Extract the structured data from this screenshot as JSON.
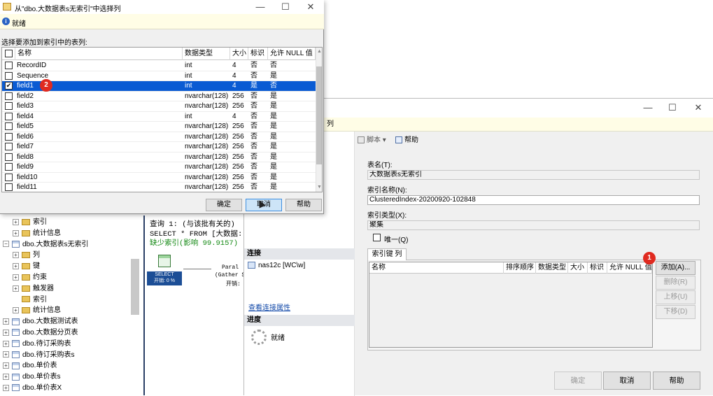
{
  "tree": {
    "rows": [
      {
        "label": "索引",
        "kind": "folder",
        "expander": "+"
      },
      {
        "label": "统计信息",
        "kind": "folder",
        "expander": "+"
      },
      {
        "label": "dbo.大数据表s无索引",
        "kind": "table",
        "expander": "−"
      },
      {
        "label": "列",
        "kind": "folder",
        "expander": "+"
      },
      {
        "label": "键",
        "kind": "folder",
        "expander": "+"
      },
      {
        "label": "约束",
        "kind": "folder",
        "expander": "+"
      },
      {
        "label": "触发器",
        "kind": "folder",
        "expander": "+"
      },
      {
        "label": "索引",
        "kind": "folder",
        "expander": ""
      },
      {
        "label": "统计信息",
        "kind": "folder",
        "expander": "+"
      },
      {
        "label": "dbo.大数据测试表",
        "kind": "table",
        "expander": "+"
      },
      {
        "label": "dbo.大数据分页表",
        "kind": "table",
        "expander": "+"
      },
      {
        "label": "dbo.待订采购表",
        "kind": "table",
        "expander": "+"
      },
      {
        "label": "dbo.待订采购表s",
        "kind": "table",
        "expander": "+"
      },
      {
        "label": "dbo.单价表",
        "kind": "table",
        "expander": "+"
      },
      {
        "label": "dbo.单价表s",
        "kind": "table",
        "expander": "+"
      },
      {
        "label": "dbo.单价表X",
        "kind": "table",
        "expander": "+"
      }
    ]
  },
  "query_plan": {
    "line1": "查询 1: (与该批有关的)",
    "line2": "SELECT * FROM [大数据:",
    "line3": "缺少索引(影响 99.9157)",
    "select_label": "SELECT",
    "select_cost": "开销: 0 %",
    "parallel_label": "Paral",
    "gather_label": "(Gather S",
    "parallel_cost": "开销:"
  },
  "index_dialog": {
    "minimize": "—",
    "maximize": "☐",
    "close": "✕",
    "status": "列",
    "toolbar_script": "脚本",
    "toolbar_help": "帮助",
    "connection_header": "连接",
    "connection_server": "nas12c [WC\\w]",
    "view_connection_link": "查看连接属性",
    "progress_header": "进度",
    "progress_status": "就绪",
    "table_name_label": "表名(T):",
    "table_name_value": "大数据表s无索引",
    "index_name_label": "索引名称(N):",
    "index_name_value": "ClusteredIndex-20200920-102848",
    "index_type_label": "索引类型(X):",
    "index_type_value": "聚集",
    "unique_label": "唯一(Q)",
    "key_columns_tab": "索引键 列",
    "key_columns_headers": [
      "名称",
      "排序顺序",
      "数据类型",
      "大小",
      "标识",
      "允许 NULL 值"
    ],
    "add_button": "添加(A)...",
    "remove_button": "删除(R)",
    "move_up_button": "上移(U)",
    "move_down_button": "下移(D)",
    "ok_button": "确定",
    "cancel_button": "取消",
    "help_button": "帮助",
    "badge": "1"
  },
  "select_dialog": {
    "title": "从\"dbo.大数据表s无索引\"中选择列",
    "minimize": "—",
    "maximize": "☐",
    "close": "✕",
    "status": "就绪",
    "instruction": "选择要添加到索引中的表列:",
    "headers": [
      "名称",
      "数据类型",
      "大小",
      "标识",
      "允许 NULL 值"
    ],
    "rows": [
      {
        "checked": false,
        "name": "RecordID",
        "type": "int",
        "size": "4",
        "identity": "否",
        "nullable": "否"
      },
      {
        "checked": false,
        "name": "Sequence",
        "type": "int",
        "size": "4",
        "identity": "否",
        "nullable": "是"
      },
      {
        "checked": true,
        "name": "field1",
        "type": "int",
        "size": "4",
        "identity": "是",
        "nullable": "否",
        "selected": true
      },
      {
        "checked": false,
        "name": "field2",
        "type": "nvarchar(128)",
        "size": "256",
        "identity": "否",
        "nullable": "是"
      },
      {
        "checked": false,
        "name": "field3",
        "type": "nvarchar(128)",
        "size": "256",
        "identity": "否",
        "nullable": "是"
      },
      {
        "checked": false,
        "name": "field4",
        "type": "int",
        "size": "4",
        "identity": "否",
        "nullable": "是"
      },
      {
        "checked": false,
        "name": "field5",
        "type": "nvarchar(128)",
        "size": "256",
        "identity": "否",
        "nullable": "是"
      },
      {
        "checked": false,
        "name": "field6",
        "type": "nvarchar(128)",
        "size": "256",
        "identity": "否",
        "nullable": "是"
      },
      {
        "checked": false,
        "name": "field7",
        "type": "nvarchar(128)",
        "size": "256",
        "identity": "否",
        "nullable": "是"
      },
      {
        "checked": false,
        "name": "field8",
        "type": "nvarchar(128)",
        "size": "256",
        "identity": "否",
        "nullable": "是"
      },
      {
        "checked": false,
        "name": "field9",
        "type": "nvarchar(128)",
        "size": "256",
        "identity": "否",
        "nullable": "是"
      },
      {
        "checked": false,
        "name": "field10",
        "type": "nvarchar(128)",
        "size": "256",
        "identity": "否",
        "nullable": "是"
      },
      {
        "checked": false,
        "name": "field11",
        "type": "nvarchar(128)",
        "size": "256",
        "identity": "否",
        "nullable": "是"
      }
    ],
    "ok_button": "确定",
    "cancel_button": "取消",
    "help_button": "帮助",
    "badge": "2",
    "check_mark": "✔"
  }
}
